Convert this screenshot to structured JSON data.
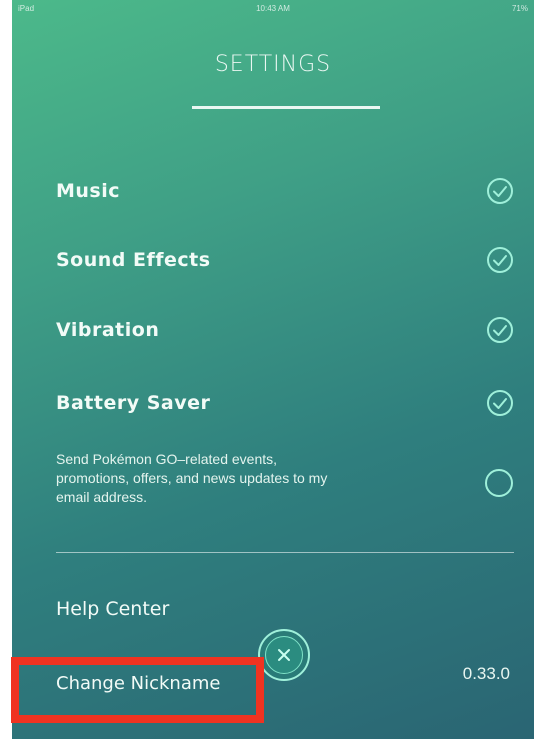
{
  "colors": {
    "accent": "#9ff0da",
    "highlight": "#ef3321",
    "text": "#f2fbf7"
  },
  "statusbar": {
    "left": "iPad",
    "center": "10:43 AM",
    "right": "71%"
  },
  "header": {
    "title": "SETTINGS"
  },
  "settings": [
    {
      "label": "Music",
      "checked": true,
      "icon": "check-circle-icon"
    },
    {
      "label": "Sound Effects",
      "checked": true,
      "icon": "check-circle-icon"
    },
    {
      "label": "Vibration",
      "checked": true,
      "icon": "check-circle-icon"
    },
    {
      "label": "Battery Saver",
      "checked": true,
      "icon": "check-circle-icon"
    }
  ],
  "email_opt_in": {
    "line1": "Send Pokémon GO–related events,",
    "line2": "promotions, offers, and news updates to my",
    "line3": "email address.",
    "checked": false,
    "icon": "empty-circle-icon"
  },
  "links": {
    "help_center": "Help Center",
    "change_nickname": "Change Nickname"
  },
  "version": "0.33.0",
  "close_button": {
    "icon": "close-icon"
  }
}
